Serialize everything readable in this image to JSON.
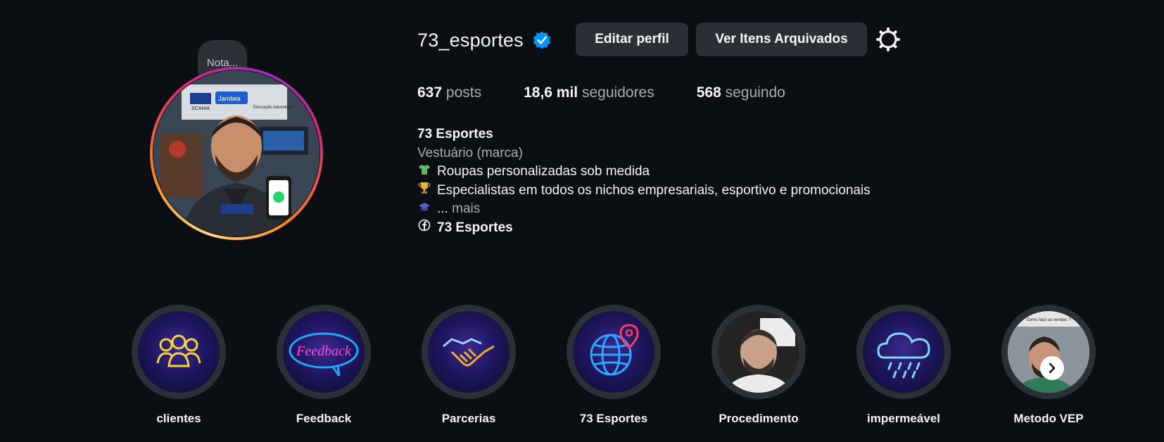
{
  "profile": {
    "username": "73_esportes",
    "note": "Nota...",
    "buttons": {
      "edit": "Editar perfil",
      "archive": "Ver Itens Arquivados"
    },
    "stats": {
      "posts_value": "637",
      "posts_label": "posts",
      "followers_value": "18,6 mil",
      "followers_label": "seguidores",
      "following_value": "568",
      "following_label": "seguindo"
    },
    "bio": {
      "name": "73 Esportes",
      "category": "Vestuário (marca)",
      "line1": "Roupas personalizadas sob medida",
      "line2": "Especialistas em todos os nichos empresariais, esportivo e promocionais",
      "line3": "...",
      "more": "mais",
      "facebook_link": "73 Esportes"
    },
    "avatar_sign_labels": {
      "brand1": "SCANIA",
      "brand2": "Jandaia",
      "brand3": "Educação Adventista"
    }
  },
  "highlights": [
    {
      "label": "clientes",
      "icon": "users-neon-icon"
    },
    {
      "label": "Feedback",
      "icon": "feedback-neon-icon",
      "icon_text": "Feedback"
    },
    {
      "label": "Parcerias",
      "icon": "handshake-neon-icon"
    },
    {
      "label": "73 Esportes",
      "icon": "globe-pin-neon-icon"
    },
    {
      "label": "Procedimento",
      "icon": "photo-man-icon"
    },
    {
      "label": "impermeável",
      "icon": "rain-cloud-neon-icon"
    },
    {
      "label": "Metodo VEP",
      "icon": "photo-man-icon",
      "icon_text": "Como faço as vendas ?"
    }
  ],
  "colors": {
    "background": "#0b0e13",
    "button": "#2a2e35",
    "verified": "#0095f6",
    "muted": "#a8adb4"
  }
}
